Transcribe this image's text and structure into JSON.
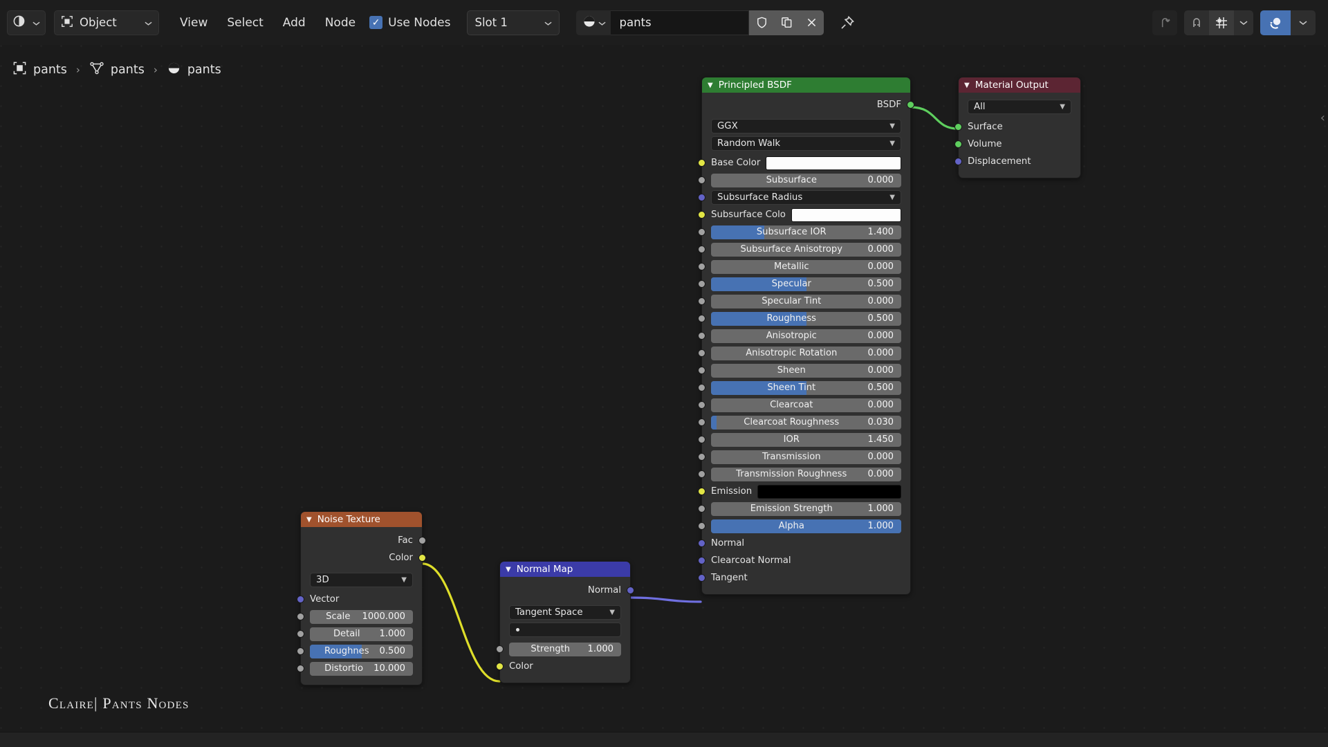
{
  "header": {
    "editor_type_icon": "shader-editor-icon",
    "mode": "Object",
    "mode_icon": "object-mode-icon",
    "menus": [
      "View",
      "Select",
      "Add",
      "Node"
    ],
    "use_nodes": {
      "label": "Use Nodes",
      "checked": true
    },
    "slot": "Slot 1",
    "material_browse_icon": "material-sphere-icon",
    "material_name": "pants",
    "material_name_placeholder": "Name",
    "buttons": {
      "fake_user": "shield-icon",
      "duplicate": "copy-icon",
      "unlink": "close-icon",
      "pin": "pin-icon"
    },
    "right_tools": {
      "snap_parent": "arrow-up-icon",
      "magnet": "magnet-icon",
      "snap_mode": "snap-grid-icon",
      "snap_dropdown": "chevron-down-icon",
      "overlays": "overlays-icon",
      "overlays_dropdown": "chevron-down-icon"
    }
  },
  "breadcrumb": {
    "items": [
      {
        "icon": "object-icon",
        "label": "pants"
      },
      {
        "icon": "mesh-data-icon",
        "label": "pants"
      },
      {
        "icon": "material-icon",
        "label": "pants"
      }
    ],
    "separator": "›"
  },
  "sidebar_toggle_icon": "chevron-left-icon",
  "watermark": "Claire| Pants Nodes",
  "nodes": {
    "principled_bsdf": {
      "title": "Principled BSDF",
      "header_color": "#2e7d32",
      "outputs": [
        {
          "name": "BSDF",
          "socket": "green"
        }
      ],
      "distribution": "GGX",
      "subsurface_method": "Random Walk",
      "inputs": [
        {
          "name": "Base Color",
          "type": "color",
          "socket": "yellow",
          "color": "#fdfdfd"
        },
        {
          "name": "Subsurface",
          "type": "slider",
          "socket": "gray",
          "value": "0.000",
          "fill": 0
        },
        {
          "name": "Subsurface Radius",
          "type": "dropdown",
          "socket": "purple",
          "value": ""
        },
        {
          "name": "Subsurface Colo",
          "type": "color",
          "socket": "yellow",
          "color": "#fdfdfd"
        },
        {
          "name": "Subsurface IOR",
          "type": "slider",
          "socket": "gray",
          "value": "1.400",
          "fill": 28
        },
        {
          "name": "Subsurface Anisotropy",
          "type": "slider",
          "socket": "gray",
          "value": "0.000",
          "fill": 0
        },
        {
          "name": "Metallic",
          "type": "slider",
          "socket": "gray",
          "value": "0.000",
          "fill": 0
        },
        {
          "name": "Specular",
          "type": "slider",
          "socket": "gray",
          "value": "0.500",
          "fill": 50
        },
        {
          "name": "Specular Tint",
          "type": "slider",
          "socket": "gray",
          "value": "0.000",
          "fill": 0
        },
        {
          "name": "Roughness",
          "type": "slider",
          "socket": "gray",
          "value": "0.500",
          "fill": 50
        },
        {
          "name": "Anisotropic",
          "type": "slider",
          "socket": "gray",
          "value": "0.000",
          "fill": 0
        },
        {
          "name": "Anisotropic Rotation",
          "type": "slider",
          "socket": "gray",
          "value": "0.000",
          "fill": 0
        },
        {
          "name": "Sheen",
          "type": "slider",
          "socket": "gray",
          "value": "0.000",
          "fill": 0
        },
        {
          "name": "Sheen Tint",
          "type": "slider",
          "socket": "gray",
          "value": "0.500",
          "fill": 50
        },
        {
          "name": "Clearcoat",
          "type": "slider",
          "socket": "gray",
          "value": "0.000",
          "fill": 0
        },
        {
          "name": "Clearcoat Roughness",
          "type": "slider",
          "socket": "gray",
          "value": "0.030",
          "fill": 3
        },
        {
          "name": "IOR",
          "type": "slider",
          "socket": "gray",
          "value": "1.450",
          "fill": 0
        },
        {
          "name": "Transmission",
          "type": "slider",
          "socket": "gray",
          "value": "0.000",
          "fill": 0
        },
        {
          "name": "Transmission Roughness",
          "type": "slider",
          "socket": "gray",
          "value": "0.000",
          "fill": 0
        },
        {
          "name": "Emission",
          "type": "color",
          "socket": "yellow",
          "color": "#000000"
        },
        {
          "name": "Emission Strength",
          "type": "slider",
          "socket": "gray",
          "value": "1.000",
          "fill": 0
        },
        {
          "name": "Alpha",
          "type": "slider",
          "socket": "gray",
          "value": "1.000",
          "fill": 100
        },
        {
          "name": "Normal",
          "type": "plain",
          "socket": "purple"
        },
        {
          "name": "Clearcoat Normal",
          "type": "plain",
          "socket": "purple"
        },
        {
          "name": "Tangent",
          "type": "plain",
          "socket": "purple"
        }
      ]
    },
    "material_output": {
      "title": "Material Output",
      "header_color": "#5c2533",
      "target": "All",
      "inputs": [
        {
          "name": "Surface",
          "socket": "green"
        },
        {
          "name": "Volume",
          "socket": "green"
        },
        {
          "name": "Displacement",
          "socket": "purple"
        }
      ]
    },
    "noise_texture": {
      "title": "Noise Texture",
      "header_color": "#a0522d",
      "outputs": [
        {
          "name": "Fac",
          "socket": "gray"
        },
        {
          "name": "Color",
          "socket": "yellow"
        }
      ],
      "dimensions": "3D",
      "inputs": [
        {
          "name": "Vector",
          "type": "plain",
          "socket": "purple"
        },
        {
          "name": "Scale",
          "type": "slider",
          "socket": "gray",
          "value": "1000.000",
          "fill": 0
        },
        {
          "name": "Detail",
          "type": "slider",
          "socket": "gray",
          "value": "1.000",
          "fill": 0
        },
        {
          "name": "Roughnes",
          "type": "slider",
          "socket": "gray",
          "value": "0.500",
          "fill": 50
        },
        {
          "name": "Distortio",
          "type": "slider",
          "socket": "gray",
          "value": "10.000",
          "fill": 0
        }
      ]
    },
    "normal_map": {
      "title": "Normal Map",
      "header_color": "#3b3ba8",
      "outputs": [
        {
          "name": "Normal",
          "socket": "purple"
        }
      ],
      "space": "Tangent Space",
      "uv_map": "",
      "inputs": [
        {
          "name": "Strength",
          "type": "slider",
          "socket": "gray",
          "value": "1.000",
          "fill": 0
        },
        {
          "name": "Color",
          "type": "plain",
          "socket": "yellow"
        }
      ]
    }
  },
  "links": [
    {
      "from": "Noise Texture.Color",
      "to": "Normal Map.Color",
      "color": "#dede2a"
    },
    {
      "from": "Normal Map.Normal",
      "to": "Principled BSDF.Normal",
      "color": "#6f6fe0"
    },
    {
      "from": "Principled BSDF.BSDF",
      "to": "Material Output.Surface",
      "color": "#5ece5e"
    }
  ],
  "colors": {
    "accent_blue": "#4772b3",
    "canvas_bg": "#1b1b1b",
    "node_bg": "#303030",
    "slider_bg": "#6a6a6a"
  }
}
